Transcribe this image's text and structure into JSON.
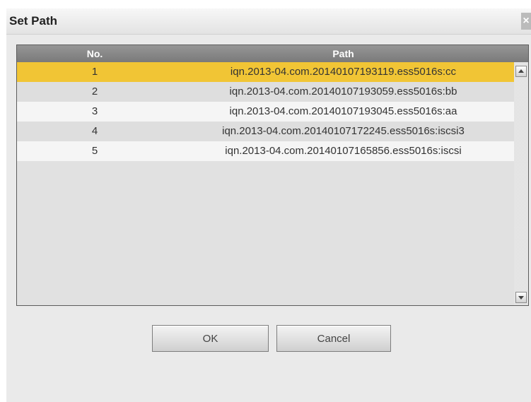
{
  "dialog": {
    "title": "Set Path",
    "close_glyph": "×"
  },
  "table": {
    "columns": [
      "No.",
      "Path"
    ],
    "selected_row": 0,
    "rows": [
      {
        "no": "1",
        "path": "iqn.2013-04.com.20140107193119.ess5016s:cc"
      },
      {
        "no": "2",
        "path": "iqn.2013-04.com.20140107193059.ess5016s:bb"
      },
      {
        "no": "3",
        "path": "iqn.2013-04.com.20140107193045.ess5016s:aa"
      },
      {
        "no": "4",
        "path": "iqn.2013-04.com.20140107172245.ess5016s:iscsi3"
      },
      {
        "no": "5",
        "path": "iqn.2013-04.com.20140107165856.ess5016s:iscsi"
      }
    ]
  },
  "buttons": {
    "ok_label": "OK",
    "cancel_label": "Cancel"
  },
  "colors": {
    "selected_row": "#f1c535",
    "header_bg": "#8a8a8a"
  },
  "icons": {
    "close": "close-icon",
    "scroll_up": "scroll-up-arrow-icon",
    "scroll_down": "scroll-down-arrow-icon"
  }
}
